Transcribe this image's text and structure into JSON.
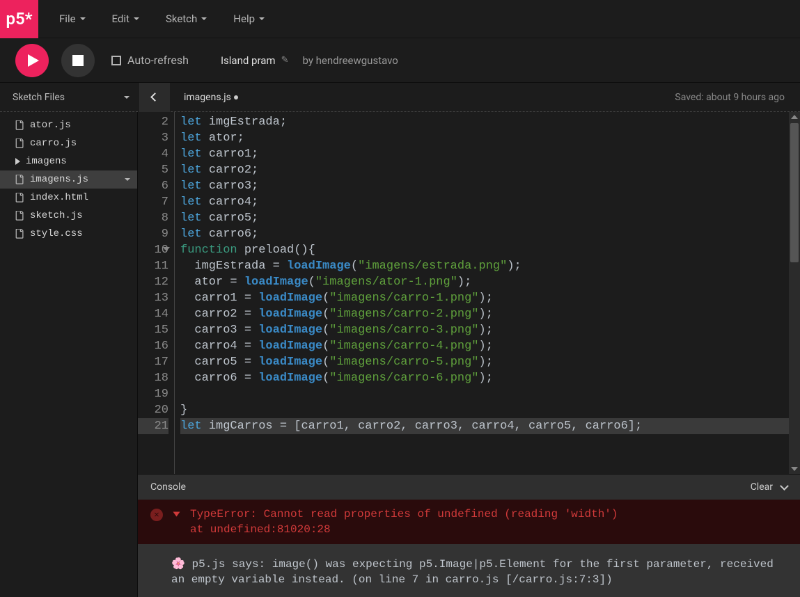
{
  "logo": "p5*",
  "menu": [
    "File",
    "Edit",
    "Sketch",
    "Help"
  ],
  "toolbar": {
    "auto_refresh": "Auto-refresh",
    "project_name": "Island pram",
    "by": "by",
    "author": "hendreewgustavo"
  },
  "workbar": {
    "sketch_files": "Sketch Files",
    "filename": "imagens.js",
    "saved": "Saved: about 9 hours ago"
  },
  "files": [
    {
      "name": "ator.js",
      "type": "file"
    },
    {
      "name": "carro.js",
      "type": "file"
    },
    {
      "name": "imagens",
      "type": "folder"
    },
    {
      "name": "imagens.js",
      "type": "file",
      "selected": true
    },
    {
      "name": "index.html",
      "type": "file"
    },
    {
      "name": "sketch.js",
      "type": "file"
    },
    {
      "name": "style.css",
      "type": "file"
    }
  ],
  "code": {
    "start": 2,
    "lines": [
      {
        "n": 2,
        "t": [
          [
            "kw",
            "let "
          ],
          [
            "id",
            "imgEstrada"
          ],
          [
            "pun",
            ";"
          ]
        ]
      },
      {
        "n": 3,
        "t": [
          [
            "kw",
            "let "
          ],
          [
            "id",
            "ator"
          ],
          [
            "pun",
            ";"
          ]
        ]
      },
      {
        "n": 4,
        "t": [
          [
            "kw",
            "let "
          ],
          [
            "id",
            "carro1"
          ],
          [
            "pun",
            ";"
          ]
        ]
      },
      {
        "n": 5,
        "t": [
          [
            "kw",
            "let "
          ],
          [
            "id",
            "carro2"
          ],
          [
            "pun",
            ";"
          ]
        ]
      },
      {
        "n": 6,
        "t": [
          [
            "kw",
            "let "
          ],
          [
            "id",
            "carro3"
          ],
          [
            "pun",
            ";"
          ]
        ]
      },
      {
        "n": 7,
        "t": [
          [
            "kw",
            "let "
          ],
          [
            "id",
            "carro4"
          ],
          [
            "pun",
            ";"
          ]
        ]
      },
      {
        "n": 8,
        "t": [
          [
            "kw",
            "let "
          ],
          [
            "id",
            "carro5"
          ],
          [
            "pun",
            ";"
          ]
        ]
      },
      {
        "n": 9,
        "t": [
          [
            "kw",
            "let "
          ],
          [
            "id",
            "carro6"
          ],
          [
            "pun",
            ";"
          ]
        ]
      },
      {
        "n": 10,
        "fold": true,
        "t": [
          [
            "def",
            "function "
          ],
          [
            "id",
            "preload"
          ],
          [
            "pun",
            "(){"
          ]
        ]
      },
      {
        "n": 11,
        "t": [
          [
            "pun",
            "  "
          ],
          [
            "id",
            "imgEstrada "
          ],
          [
            "pun",
            "= "
          ],
          [
            "fn",
            "loadImage"
          ],
          [
            "pun",
            "("
          ],
          [
            "str",
            "\"imagens/estrada.png\""
          ],
          [
            "pun",
            ");"
          ]
        ]
      },
      {
        "n": 12,
        "t": [
          [
            "pun",
            "  "
          ],
          [
            "id",
            "ator "
          ],
          [
            "pun",
            "= "
          ],
          [
            "fn",
            "loadImage"
          ],
          [
            "pun",
            "("
          ],
          [
            "str",
            "\"imagens/ator-1.png\""
          ],
          [
            "pun",
            ");"
          ]
        ]
      },
      {
        "n": 13,
        "t": [
          [
            "pun",
            "  "
          ],
          [
            "id",
            "carro1 "
          ],
          [
            "pun",
            "= "
          ],
          [
            "fn",
            "loadImage"
          ],
          [
            "pun",
            "("
          ],
          [
            "str",
            "\"imagens/carro-1.png\""
          ],
          [
            "pun",
            ");"
          ]
        ]
      },
      {
        "n": 14,
        "t": [
          [
            "pun",
            "  "
          ],
          [
            "id",
            "carro2 "
          ],
          [
            "pun",
            "= "
          ],
          [
            "fn",
            "loadImage"
          ],
          [
            "pun",
            "("
          ],
          [
            "str",
            "\"imagens/carro-2.png\""
          ],
          [
            "pun",
            ");"
          ]
        ]
      },
      {
        "n": 15,
        "t": [
          [
            "pun",
            "  "
          ],
          [
            "id",
            "carro3 "
          ],
          [
            "pun",
            "= "
          ],
          [
            "fn",
            "loadImage"
          ],
          [
            "pun",
            "("
          ],
          [
            "str",
            "\"imagens/carro-3.png\""
          ],
          [
            "pun",
            ");"
          ]
        ]
      },
      {
        "n": 16,
        "t": [
          [
            "pun",
            "  "
          ],
          [
            "id",
            "carro4 "
          ],
          [
            "pun",
            "= "
          ],
          [
            "fn",
            "loadImage"
          ],
          [
            "pun",
            "("
          ],
          [
            "str",
            "\"imagens/carro-4.png\""
          ],
          [
            "pun",
            ");"
          ]
        ]
      },
      {
        "n": 17,
        "t": [
          [
            "pun",
            "  "
          ],
          [
            "id",
            "carro5 "
          ],
          [
            "pun",
            "= "
          ],
          [
            "fn",
            "loadImage"
          ],
          [
            "pun",
            "("
          ],
          [
            "str",
            "\"imagens/carro-5.png\""
          ],
          [
            "pun",
            ");"
          ]
        ]
      },
      {
        "n": 18,
        "t": [
          [
            "pun",
            "  "
          ],
          [
            "id",
            "carro6 "
          ],
          [
            "pun",
            "= "
          ],
          [
            "fn",
            "loadImage"
          ],
          [
            "pun",
            "("
          ],
          [
            "str",
            "\"imagens/carro-6.png\""
          ],
          [
            "pun",
            ");"
          ]
        ]
      },
      {
        "n": 19,
        "t": [
          [
            "pun",
            ""
          ]
        ]
      },
      {
        "n": 20,
        "t": [
          [
            "pun",
            "}"
          ]
        ]
      },
      {
        "n": 21,
        "hl": true,
        "t": [
          [
            "kw",
            "let "
          ],
          [
            "id",
            "imgCarros "
          ],
          [
            "pun",
            "= ["
          ],
          [
            "id",
            "carro1"
          ],
          [
            "pun",
            ", "
          ],
          [
            "id",
            "carro2"
          ],
          [
            "pun",
            ", "
          ],
          [
            "id",
            "carro3"
          ],
          [
            "pun",
            ", "
          ],
          [
            "id",
            "carro4"
          ],
          [
            "pun",
            ", "
          ],
          [
            "id",
            "carro5"
          ],
          [
            "pun",
            ", "
          ],
          [
            "id",
            "carro6"
          ],
          [
            "pun",
            "];"
          ]
        ]
      }
    ]
  },
  "console": {
    "label": "Console",
    "clear": "Clear",
    "error": "TypeError: Cannot read properties of undefined (reading 'width')",
    "error_at": "  at undefined:81020:28",
    "warn": "🌸 p5.js says: image() was expecting p5.Image|p5.Element for the first parameter, received an empty variable instead. (on line 7 in carro.js [/carro.js:7:3])"
  }
}
